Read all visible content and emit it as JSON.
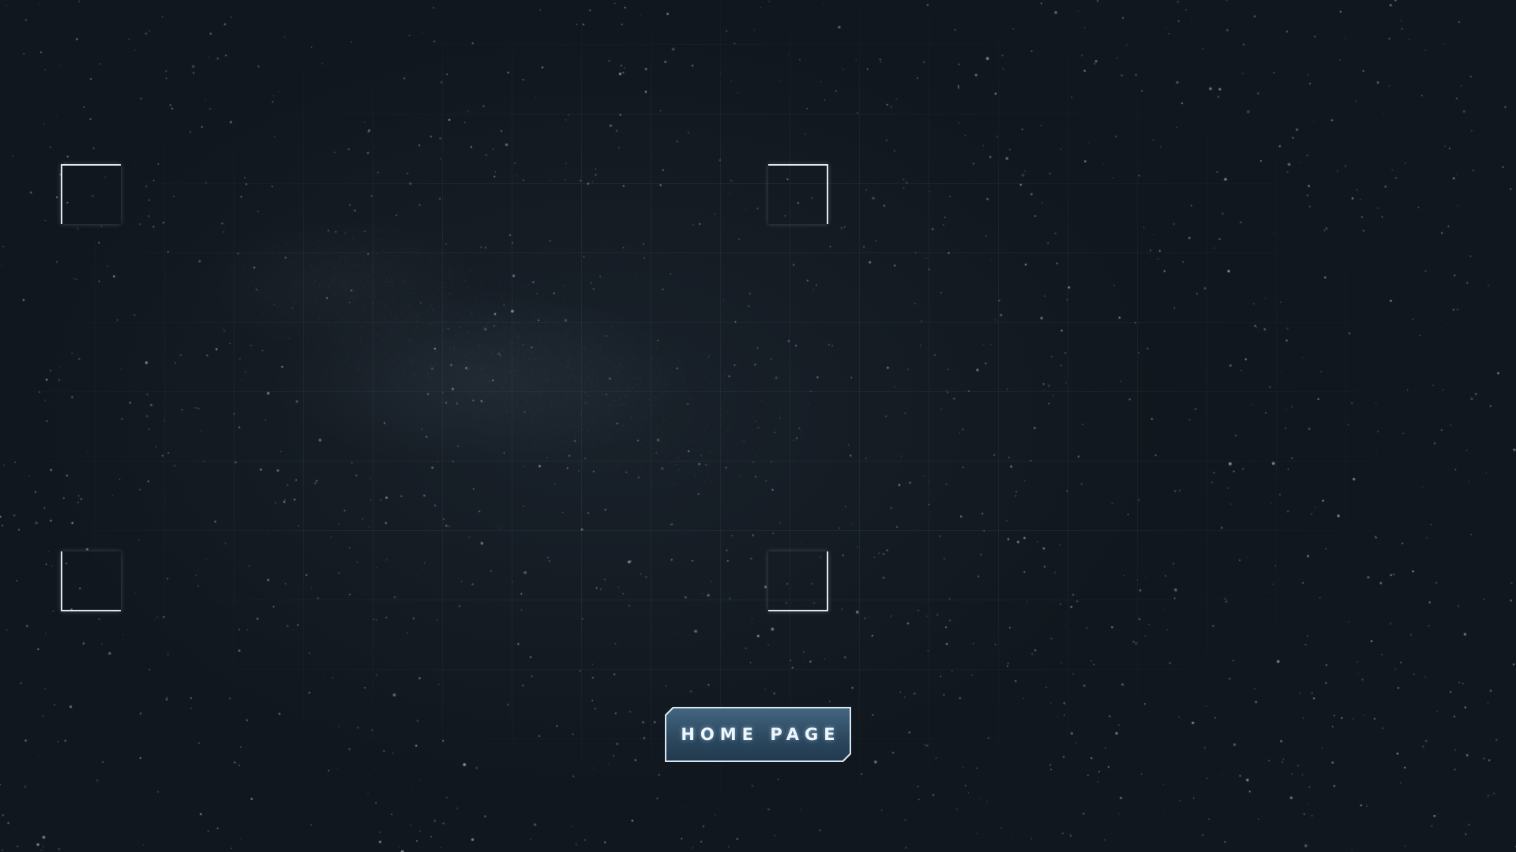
{
  "navigation": {
    "home_button_label": "HOME PAGE"
  },
  "colors": {
    "background": "#121820",
    "grid_line": "#96aab9",
    "bracket": "#dfe6ec",
    "button_fill": "#2c4960",
    "button_border": "#d7e6f2",
    "button_text": "#eef6fc"
  }
}
